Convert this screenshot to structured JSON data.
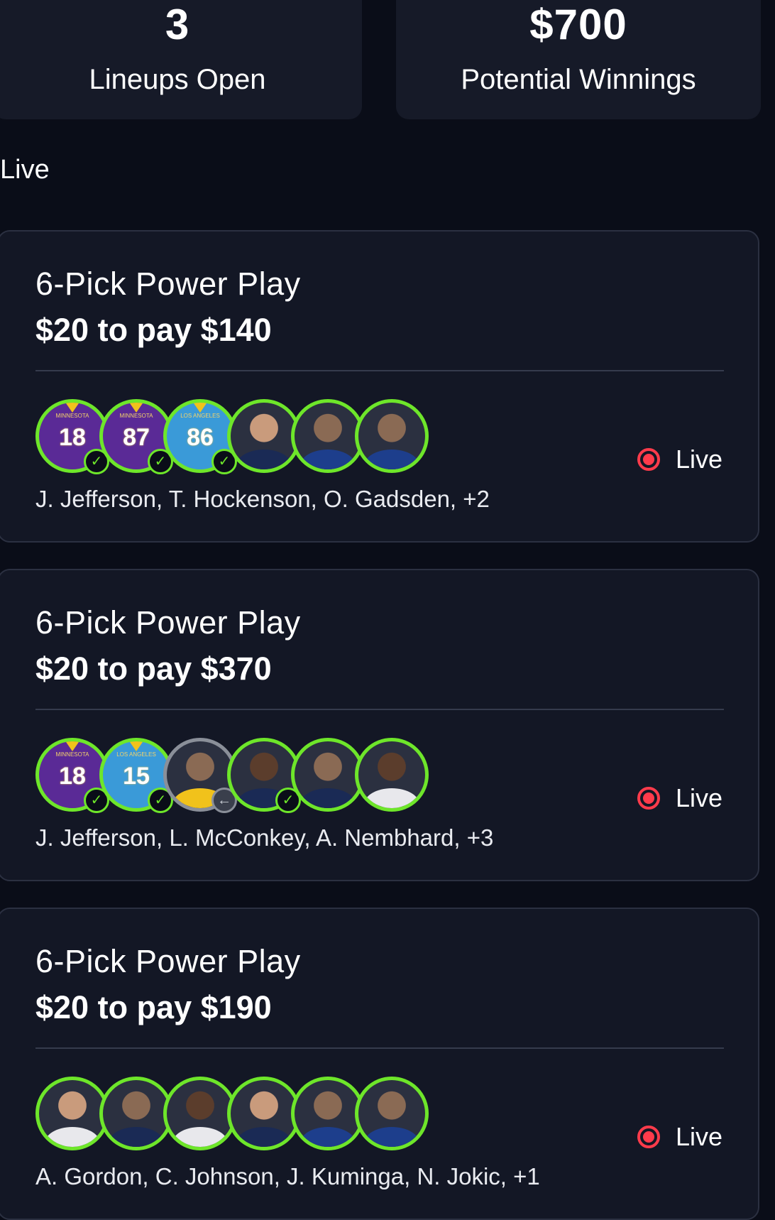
{
  "summary": {
    "lineups_value": "3",
    "lineups_label": "Lineups Open",
    "winnings_value": "$700",
    "winnings_label": "Potential Winnings"
  },
  "section": {
    "title": "Live"
  },
  "lineups": [
    {
      "title": "6-Pick Power Play",
      "payout": "$20 to pay $140",
      "status": "Live",
      "players": "J. Jefferson, T. Hockenson, O. Gadsden, +2",
      "avatars": [
        {
          "kind": "jersey",
          "team": "MINNESOTA",
          "number": "18",
          "status": "won"
        },
        {
          "kind": "jersey",
          "team": "MINNESOTA",
          "number": "87",
          "status": "won"
        },
        {
          "kind": "jersey",
          "team": "LOS ANGELES",
          "number": "86",
          "status": "won"
        },
        {
          "kind": "photo",
          "status": "live"
        },
        {
          "kind": "photo",
          "status": "live"
        },
        {
          "kind": "photo",
          "status": "live"
        }
      ]
    },
    {
      "title": "6-Pick Power Play",
      "payout": "$20 to pay $370",
      "status": "Live",
      "players": "J. Jefferson, L. McConkey, A. Nembhard, +3",
      "avatars": [
        {
          "kind": "jersey",
          "team": "MINNESOTA",
          "number": "18",
          "status": "won"
        },
        {
          "kind": "jersey",
          "team": "LOS ANGELES",
          "number": "15",
          "status": "won"
        },
        {
          "kind": "photo",
          "status": "reverted"
        },
        {
          "kind": "photo",
          "status": "won"
        },
        {
          "kind": "photo",
          "status": "live"
        },
        {
          "kind": "photo",
          "status": "live"
        }
      ]
    },
    {
      "title": "6-Pick Power Play",
      "payout": "$20 to pay $190",
      "status": "Live",
      "players": "A. Gordon, C. Johnson, J. Kuminga, N. Jokic, +1",
      "avatars": [
        {
          "kind": "photo",
          "status": "live"
        },
        {
          "kind": "photo",
          "status": "live"
        },
        {
          "kind": "photo",
          "status": "live"
        },
        {
          "kind": "photo",
          "status": "live"
        },
        {
          "kind": "photo",
          "status": "live"
        },
        {
          "kind": "photo",
          "status": "live"
        }
      ]
    }
  ],
  "icons": {
    "check": "check-icon",
    "revert": "arrow-left-icon",
    "live": "live-dot-icon"
  },
  "colors": {
    "accent_green": "#6ee62a",
    "live_red": "#ff3b4b",
    "background": "#0a0d18",
    "card": "#131725"
  }
}
